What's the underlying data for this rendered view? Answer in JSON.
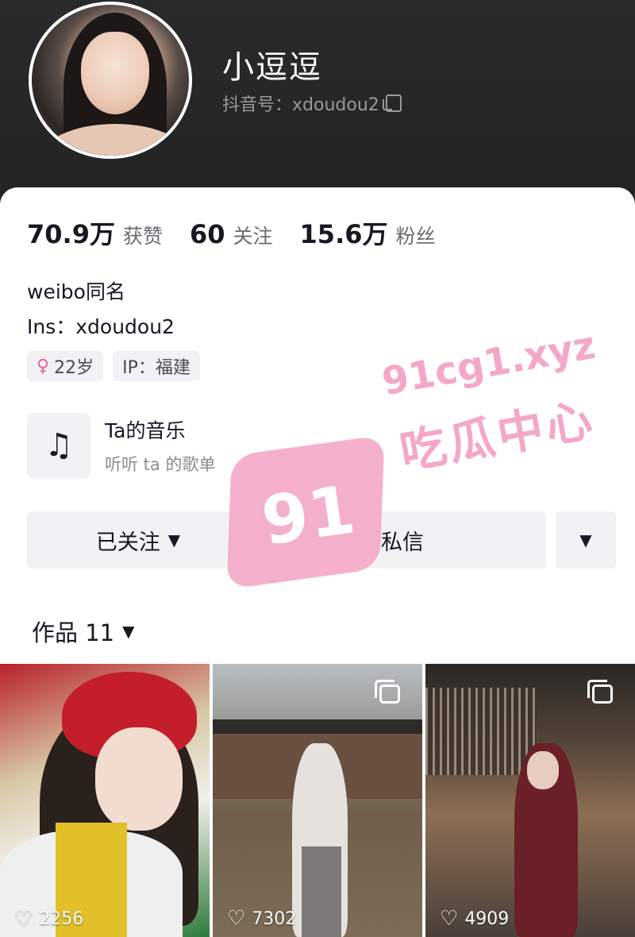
{
  "profile": {
    "nickname": "小逗逗",
    "douyin_id": "抖音号：xdoudou2"
  },
  "stats": [
    {
      "value": "70.9万",
      "label": "获赞"
    },
    {
      "value": "60",
      "label": "关注"
    },
    {
      "value": "15.6万",
      "label": "粉丝"
    }
  ],
  "bio": {
    "line1": "weibo同名",
    "line2": "Ins：xdoudou2"
  },
  "tags": {
    "age": "22岁",
    "ip": "IP：福建"
  },
  "music": {
    "icon": "music-note-icon",
    "title": "Ta的音乐",
    "subtitle": "听听 ta 的歌单"
  },
  "actions": {
    "followed_label": "已关注",
    "message_label": "私信"
  },
  "works": {
    "label": "作品 11"
  },
  "videos": [
    {
      "likes": "2256",
      "multi": false
    },
    {
      "likes": "7302",
      "multi": true
    },
    {
      "likes": "4909",
      "multi": true
    }
  ],
  "watermark": {
    "badge": "91",
    "url": "91cg1.xyz",
    "text": "吃瓜中心"
  },
  "colors": {
    "header_bg": "#262526",
    "watermark_pink": "#f4a7c9",
    "female_pink": "#f25a9d"
  }
}
